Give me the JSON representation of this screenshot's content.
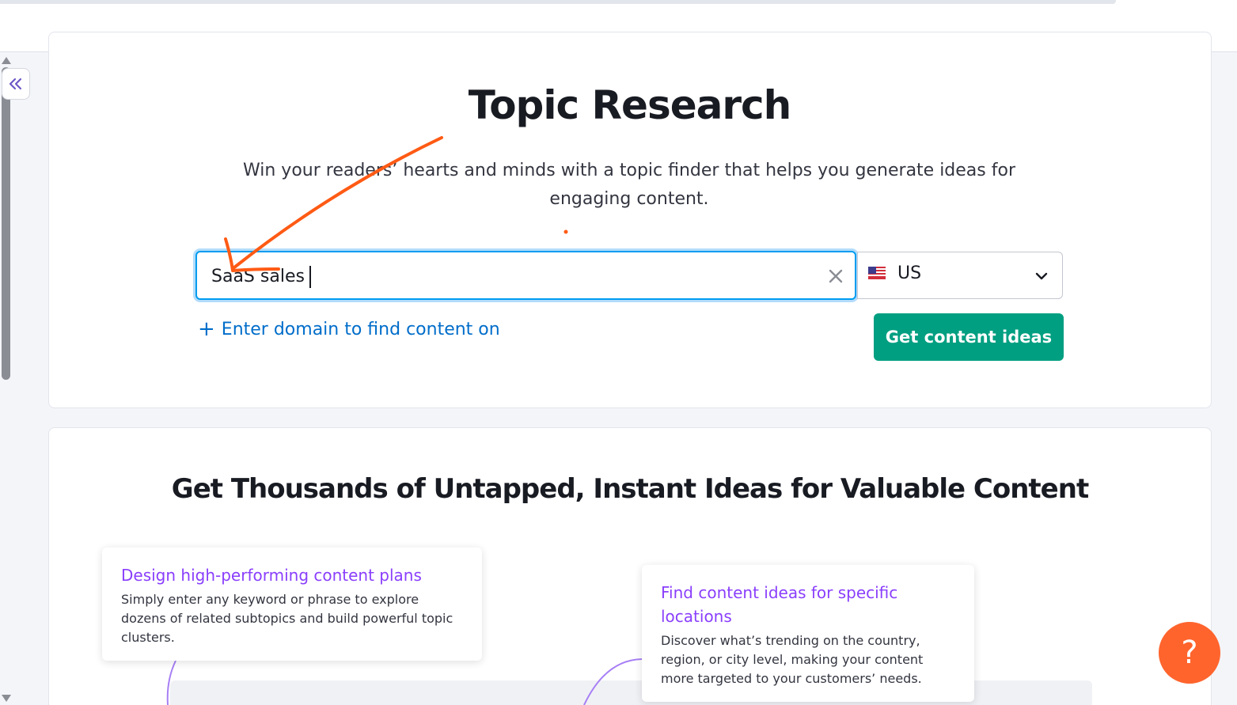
{
  "page": {
    "title": "Topic Research",
    "subtitle": "Win your readers’ hearts and minds with a topic finder that helps you generate ideas for engaging content."
  },
  "search": {
    "value": "SaaS sales",
    "clear_icon": "close-icon"
  },
  "database": {
    "flag_icon": "us-flag-icon",
    "label": "US",
    "chevron_icon": "chevron-down-icon"
  },
  "domain_link": {
    "icon": "plus-icon",
    "label": "Enter domain to find content on"
  },
  "cta": {
    "label": "Get content ideas",
    "color": "#009f81"
  },
  "section2": {
    "heading": "Get Thousands of Untapped, Instant Ideas for Valuable Content",
    "features": [
      {
        "title": "Design high-performing content plans",
        "text": "Simply enter any keyword or phrase to explore dozens of related subtopics and build powerful topic clusters."
      },
      {
        "title": "Find content ideas for specific locations",
        "text": "Discover what’s trending on the country, region, or city level, making your content more targeted to your customers’ needs."
      }
    ]
  },
  "help": {
    "label": "?",
    "color": "#ff642d"
  },
  "sidebar": {
    "collapse_icon": "double-chevron-left-icon"
  },
  "annotation": {
    "color": "#ff5a14"
  }
}
